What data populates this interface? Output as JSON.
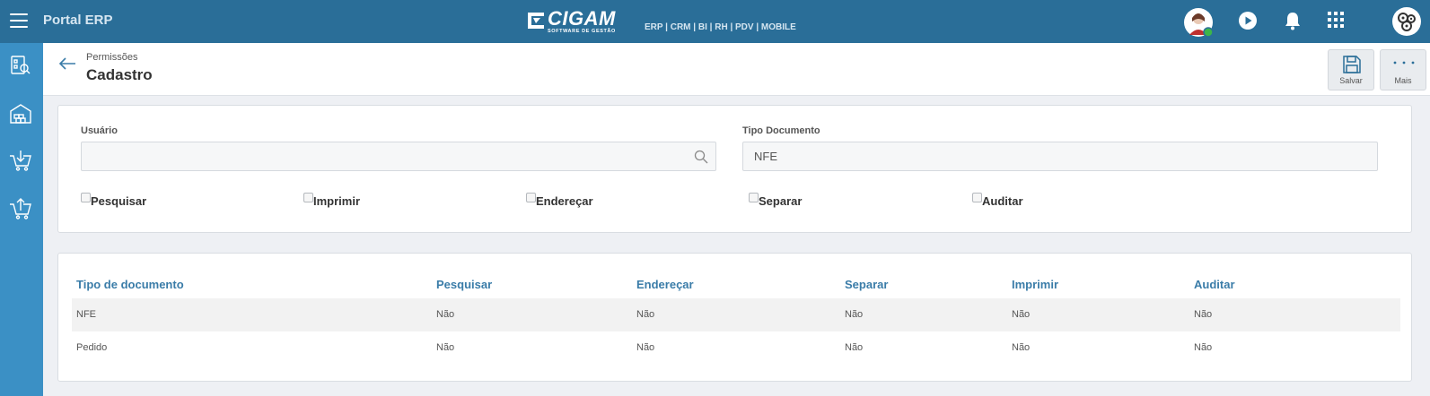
{
  "topbar": {
    "app_title": "Portal ERP",
    "logo_word": "CIGAM",
    "logo_sub": "SOFTWARE DE GESTÃO",
    "modules": "ERP | CRM | BI | RH | PDV | MOBILE",
    "icons": [
      "menu-icon",
      "user-avatar",
      "play-icon",
      "bell-icon",
      "apps-grid-icon",
      "company-avatar"
    ],
    "status_color": "#3cb54a"
  },
  "sidebar": {
    "items": [
      "report-icon",
      "warehouse-icon",
      "cart-download-icon",
      "cart-upload-icon"
    ]
  },
  "header": {
    "breadcrumb": "Permissões",
    "title": "Cadastro",
    "save_label": "Salvar",
    "more_label": "Mais"
  },
  "form": {
    "usuario_label": "Usuário",
    "usuario_value": "",
    "tipo_label": "Tipo Documento",
    "tipo_value": "NFE",
    "checkboxes": [
      {
        "label": "Pesquisar",
        "checked": false
      },
      {
        "label": "Imprimir",
        "checked": false
      },
      {
        "label": "Endereçar",
        "checked": false
      },
      {
        "label": "Separar",
        "checked": false
      },
      {
        "label": "Auditar",
        "checked": false
      }
    ]
  },
  "table": {
    "headers": [
      "Tipo de documento",
      "Pesquisar",
      "Endereçar",
      "Separar",
      "Imprimir",
      "Auditar"
    ],
    "rows": [
      [
        "NFE",
        "Não",
        "Não",
        "Não",
        "Não",
        "Não"
      ],
      [
        "Pedido",
        "Não",
        "Não",
        "Não",
        "Não",
        "Não"
      ]
    ]
  },
  "colors": {
    "topbar": "#2a6e98",
    "sidebar": "#3b90c5",
    "accent_text": "#3a7ca8"
  }
}
